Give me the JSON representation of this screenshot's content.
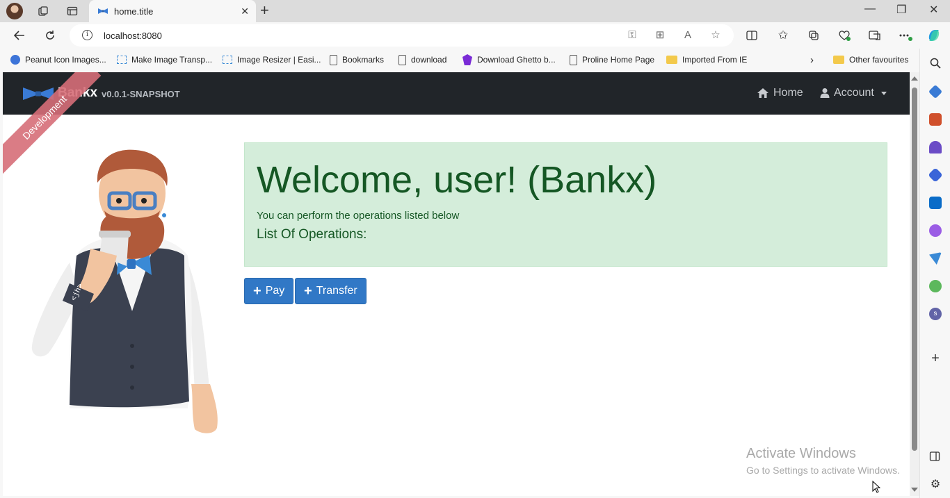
{
  "browser": {
    "tab_title": "home.title",
    "url": "localhost:8080",
    "favorites": [
      {
        "label": "Peanut Icon Images...",
        "icon": "peanut-icon"
      },
      {
        "label": "Make Image Transp...",
        "icon": "image-icon"
      },
      {
        "label": "Image Resizer | Easi...",
        "icon": "image-icon"
      },
      {
        "label": "Bookmarks",
        "icon": "document-icon"
      },
      {
        "label": "download",
        "icon": "document-icon"
      },
      {
        "label": "Download Ghetto b...",
        "icon": "ghetto-icon"
      },
      {
        "label": "Proline Home Page",
        "icon": "document-icon"
      },
      {
        "label": "Imported From IE",
        "icon": "folder-icon"
      }
    ],
    "other_favourites": "Other favourites"
  },
  "app": {
    "brand": "Bankx",
    "version": "v0.0.1-SNAPSHOT",
    "ribbon": "Development",
    "nav": {
      "home": "Home",
      "account": "Account"
    },
    "welcome_title": "Welcome, user! (Bankx)",
    "lead": "You can perform the operations listed below",
    "operations_heading": "List Of Operations:",
    "buttons": {
      "pay": "Pay",
      "transfer": "Transfer"
    }
  },
  "watermark": {
    "line1": "Activate Windows",
    "line2": "Go to Settings to activate Windows."
  },
  "colors": {
    "navbar": "#212529",
    "alert_bg": "#d4edda",
    "alert_text": "#155724",
    "primary": "#3178c6"
  }
}
